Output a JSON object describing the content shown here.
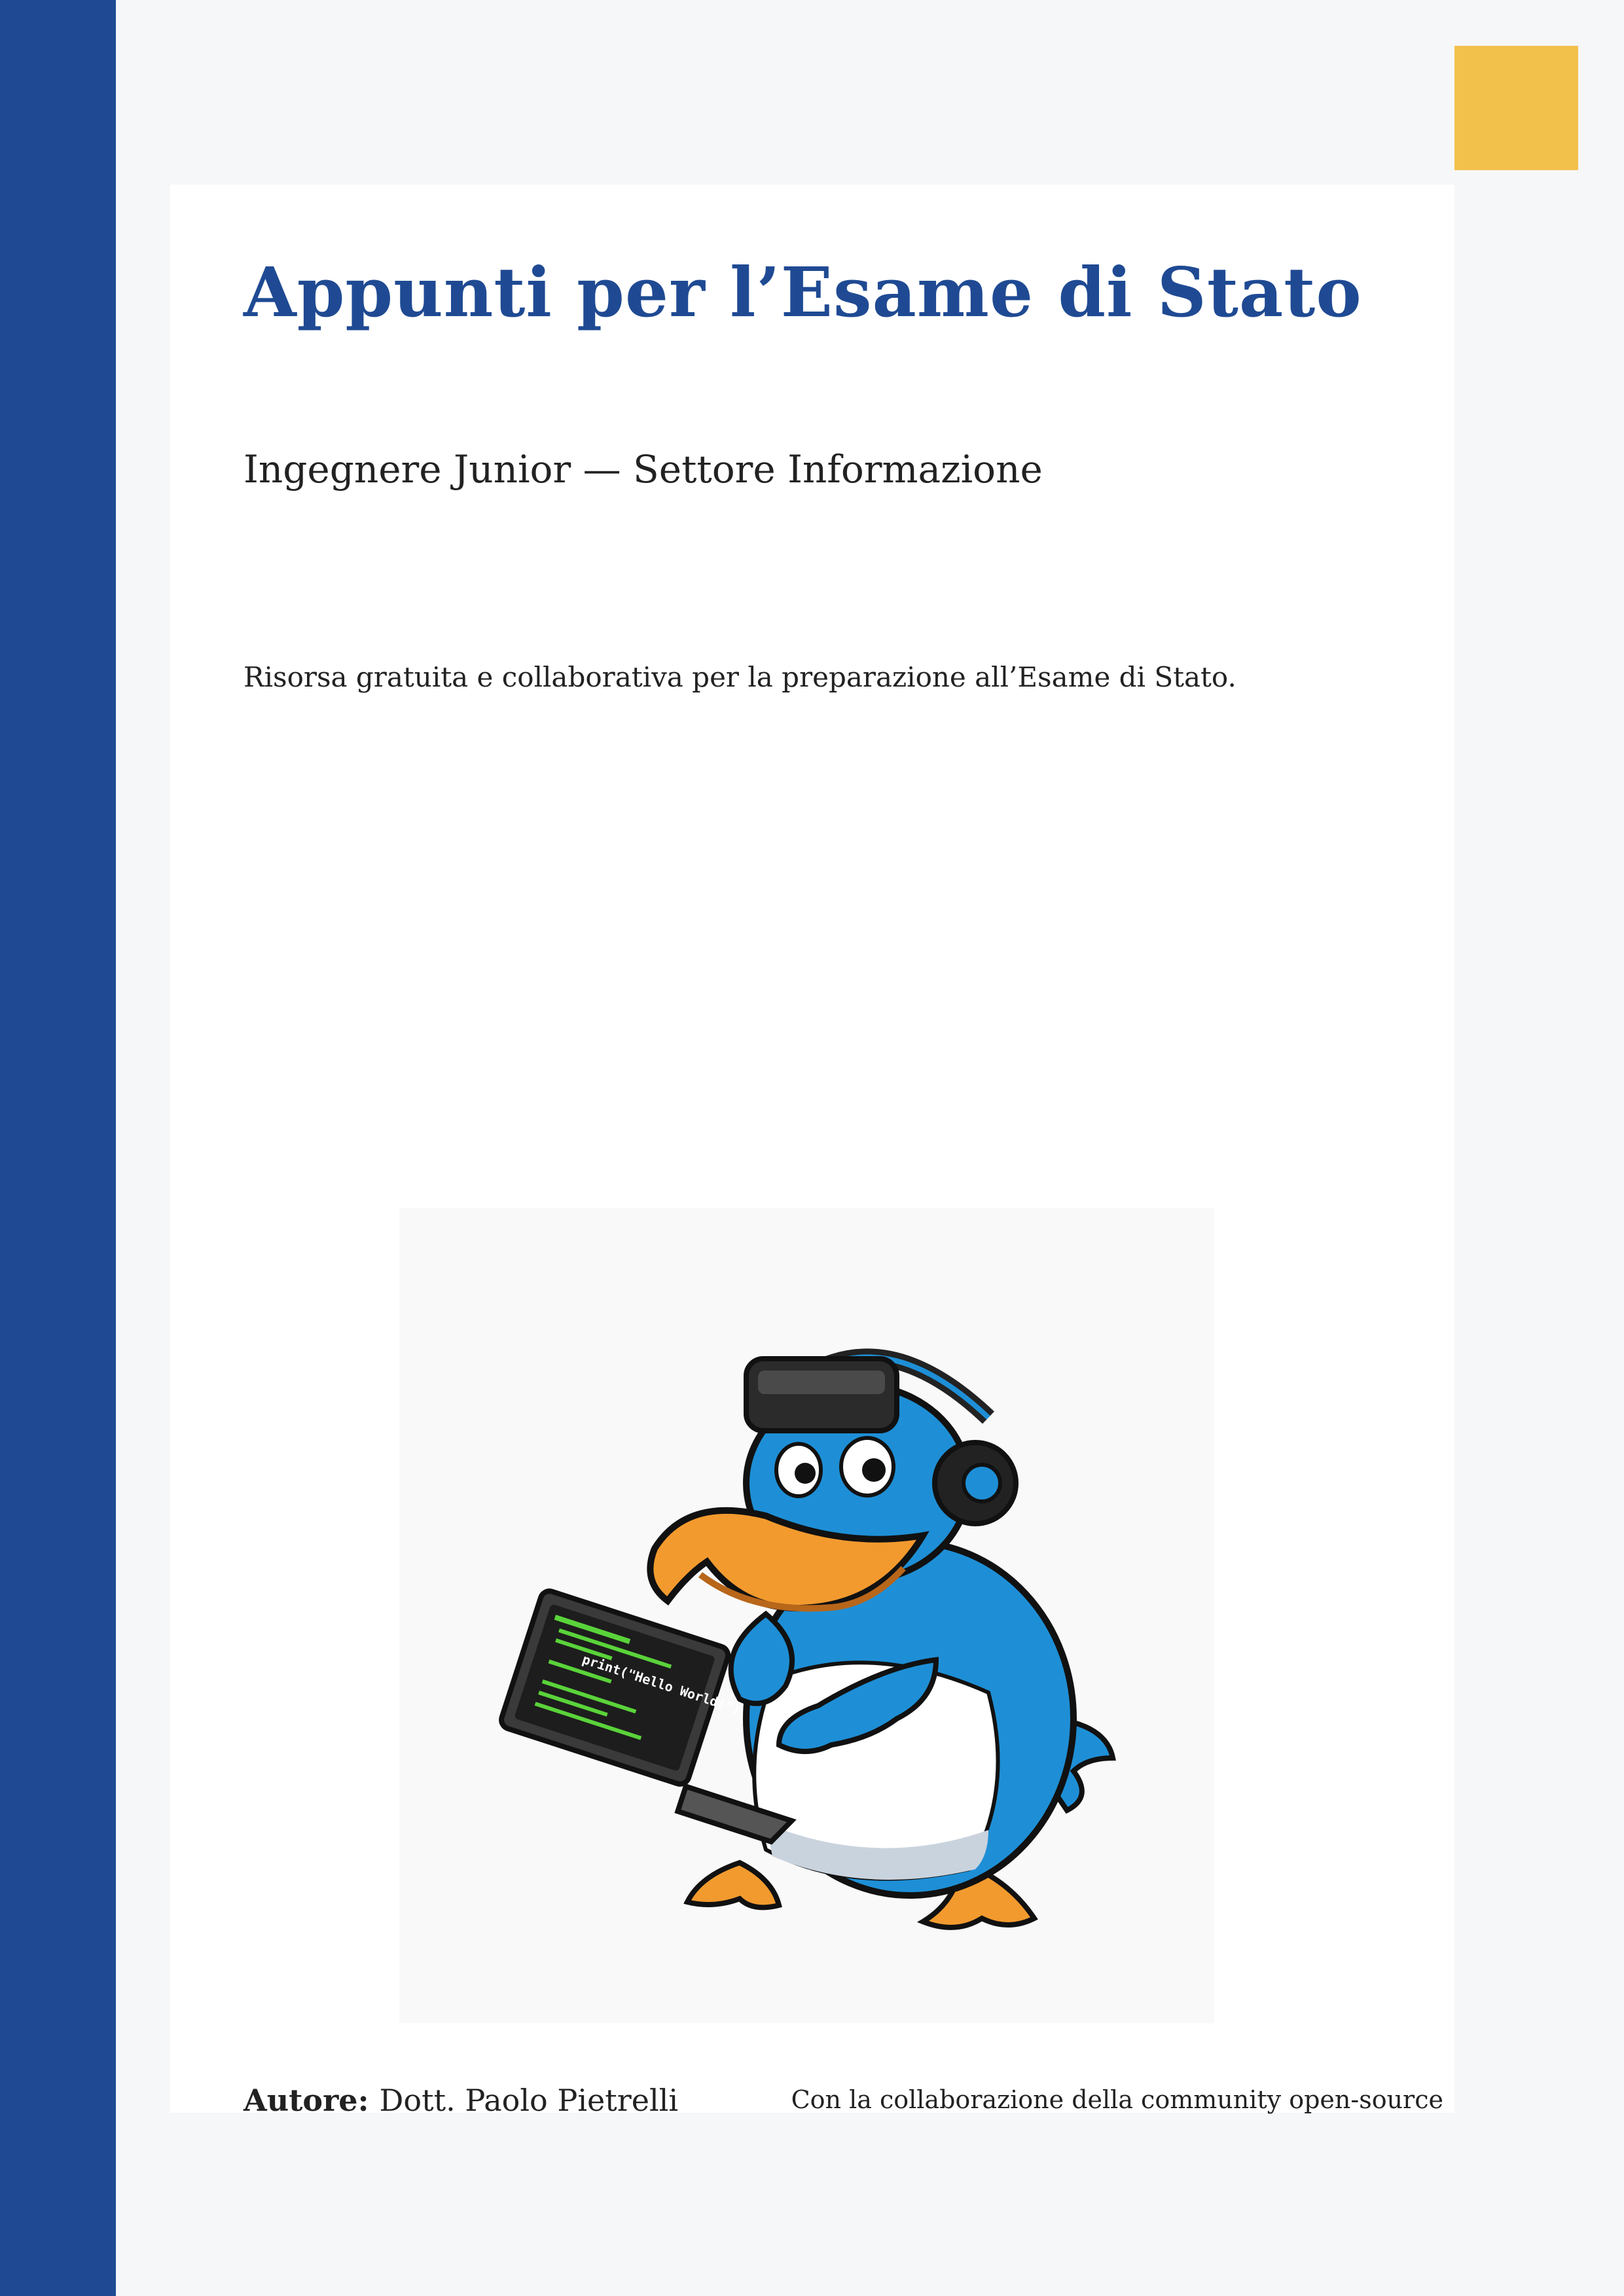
{
  "cover": {
    "title": "Appunti per l’Esame di Stato",
    "subtitle": "Ingegnere Junior — Settore Informazione",
    "tagline": "Risorsa gratuita e collaborativa per la preparazione all’Esame di Stato."
  },
  "illustration": {
    "icon": "penguin-mascot-icon",
    "screen_text": "print(\"Hello World!\")"
  },
  "footer": {
    "author_label": "Autore:",
    "author_name": "Dott. Paolo Pietrelli",
    "collaboration": "Con la collaborazione della community open-source"
  },
  "colors": {
    "accent_blue": "#1f4a93",
    "accent_yellow": "#f2c14c",
    "background": "#f6f7f9"
  }
}
